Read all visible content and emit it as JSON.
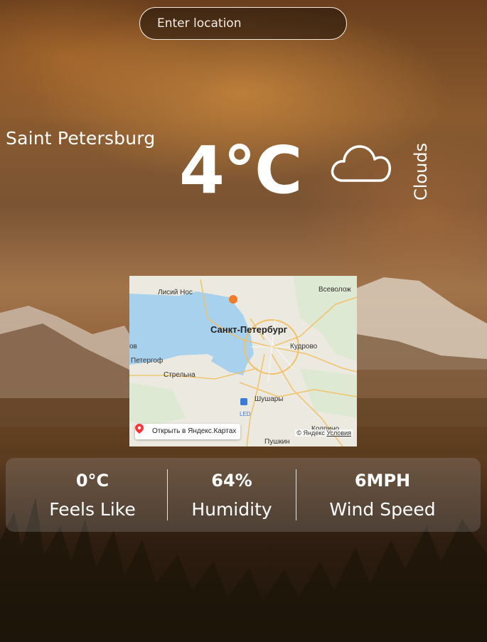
{
  "search": {
    "placeholder": "Enter location"
  },
  "weather": {
    "city": "Saint Petersburg",
    "temperature": "4°C",
    "condition": "Clouds",
    "condition_icon": "cloud-icon"
  },
  "map": {
    "labels": {
      "lisiy_nos": "Лисий Нос",
      "vsevolozhsk": "Всеволож",
      "spb": "Санкт-Петербург",
      "ov": "ов",
      "kudrovo": "Кудрово",
      "petergof": "Петергоф",
      "strelna": "Стрельна",
      "shushary": "Шушары",
      "led": "LED",
      "kolpino": "Колпино",
      "pushkin": "Пушкин"
    },
    "open_label": "Открыть в Яндекс.Картах",
    "copyright": "© Яндекс",
    "terms": "Условия"
  },
  "stats": [
    {
      "value": "0°C",
      "label": "Feels Like"
    },
    {
      "value": "64%",
      "label": "Humidity"
    },
    {
      "value": "6MPH",
      "label": "Wind Speed"
    }
  ]
}
